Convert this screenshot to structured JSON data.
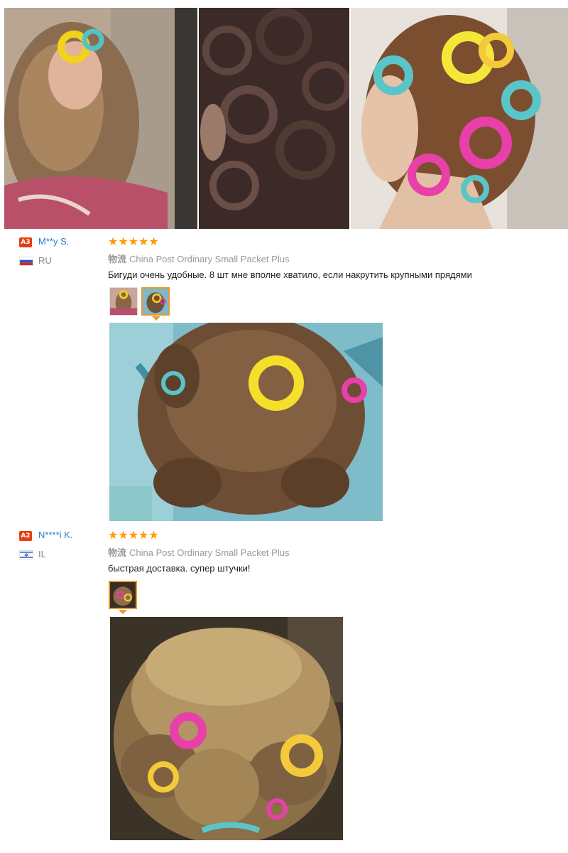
{
  "gallery": {
    "top_photos": [
      {
        "icon": "photo-woman-curls-selfie"
      },
      {
        "icon": "photo-dark-curls-closeup"
      },
      {
        "icon": "photo-head-with-rollers"
      }
    ]
  },
  "reviews": [
    {
      "badge": "A3",
      "user": "M**y S.",
      "flag_icon": "flag-ru",
      "country": "RU",
      "rating": 5,
      "stars": "★★★★★",
      "logistics_label": "物流",
      "logistics_value": "China Post Ordinary Small Packet Plus",
      "text": "Бигуди очень удобные. 8 шт мне вполне хватило, если накрутить крупными прядями",
      "thumbnails": 2,
      "active_thumbnail": 2
    },
    {
      "badge": "A2",
      "user": "N****i K.",
      "flag_icon": "flag-il",
      "country": "IL",
      "rating": 5,
      "stars": "★★★★★",
      "logistics_label": "物流",
      "logistics_value": "China Post Ordinary Small Packet Plus",
      "text": "быстрая доставка. супер штучки!",
      "thumbnails": 1,
      "active_thumbnail": 1
    }
  ],
  "colors": {
    "badge": "#e63e12",
    "username": "#2e7bcf",
    "stars": "#ff9a00",
    "thumbnail_active": "#e89a2e"
  }
}
